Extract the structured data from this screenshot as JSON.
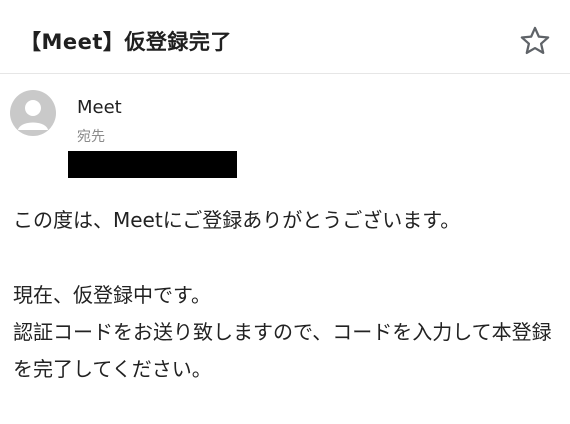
{
  "email": {
    "subject": "【Meet】仮登録完了",
    "sender": {
      "name": "Meet",
      "to_label": "宛先"
    },
    "body": {
      "paragraph_1": "この度は、Meetにご登録ありがとうございます。",
      "paragraph_2_line_1": "現在、仮登録中です。",
      "paragraph_2_line_2": "認証コードをお送り致しますので、コードを入力して本登録を完了してください。"
    }
  },
  "icons": {
    "star": "star-icon",
    "avatar": "person-avatar-icon"
  },
  "colors": {
    "text": "#222222",
    "muted": "#8a8a8a",
    "avatar": "#c9c9c9",
    "divider": "#e6e6e6"
  }
}
